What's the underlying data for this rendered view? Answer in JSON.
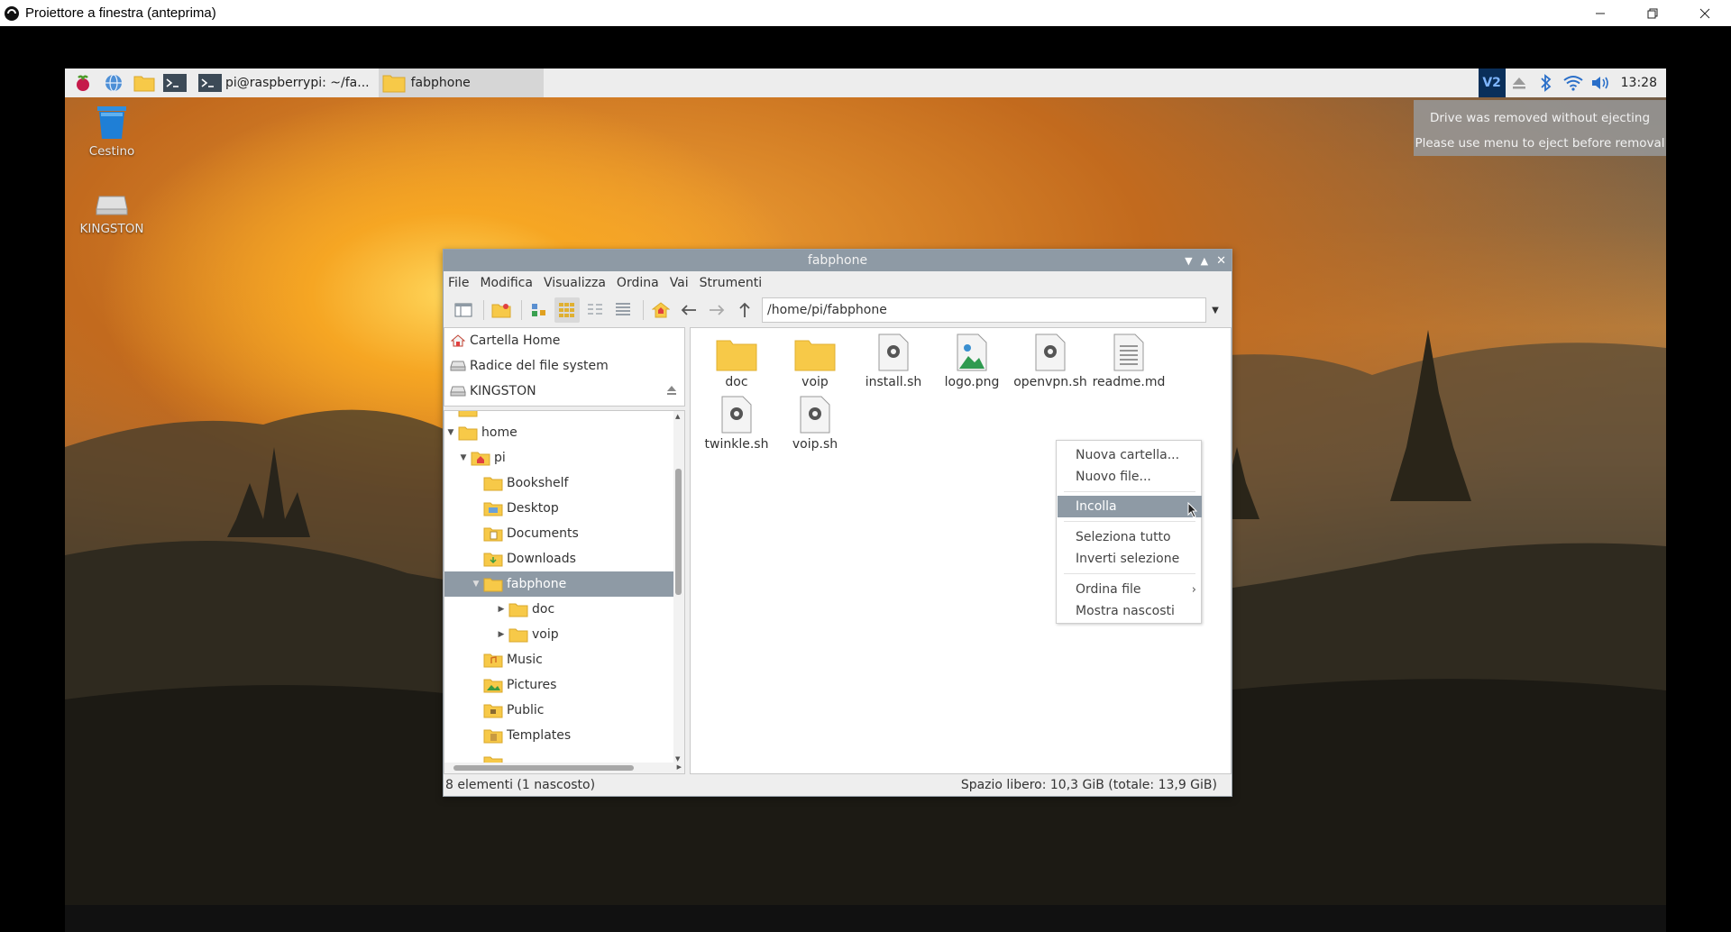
{
  "host": {
    "title": "Proiettore a finestra (anteprima)"
  },
  "taskbar": {
    "tasks": [
      {
        "label": "pi@raspberrypi: ~/fa...",
        "icon": "terminal-icon"
      },
      {
        "label": "fabphone",
        "icon": "folder-icon"
      }
    ],
    "clock": "13:28"
  },
  "notification": {
    "line1": "Drive was removed without ejecting",
    "line2": "Please use menu to eject before removal"
  },
  "desktop": {
    "icons": [
      {
        "label": "Cestino",
        "icon": "trash-icon"
      },
      {
        "label": "KINGSTON",
        "icon": "drive-icon"
      }
    ]
  },
  "file_manager": {
    "title": "fabphone",
    "menu": [
      "File",
      "Modifica",
      "Visualizza",
      "Ordina",
      "Vai",
      "Strumenti"
    ],
    "path": "/home/pi/fabphone",
    "places": [
      {
        "label": "Cartella Home",
        "icon": "home-icon"
      },
      {
        "label": "Radice del file system",
        "icon": "drive-icon"
      },
      {
        "label": "KINGSTON",
        "icon": "drive-icon"
      }
    ],
    "tree": [
      {
        "label": "home",
        "level": 0,
        "expanded": true
      },
      {
        "label": "pi",
        "level": 1,
        "expanded": true
      },
      {
        "label": "Bookshelf",
        "level": 2
      },
      {
        "label": "Desktop",
        "level": 2
      },
      {
        "label": "Documents",
        "level": 2
      },
      {
        "label": "Downloads",
        "level": 2
      },
      {
        "label": "fabphone",
        "level": 2,
        "selected": true
      },
      {
        "label": "doc",
        "level": 3
      },
      {
        "label": "voip",
        "level": 3
      },
      {
        "label": "Music",
        "level": 2
      },
      {
        "label": "Pictures",
        "level": 2
      },
      {
        "label": "Public",
        "level": 2
      },
      {
        "label": "Templates",
        "level": 2
      }
    ],
    "files": [
      {
        "name": "doc",
        "type": "folder"
      },
      {
        "name": "voip",
        "type": "folder"
      },
      {
        "name": "install.sh",
        "type": "script"
      },
      {
        "name": "logo.png",
        "type": "image"
      },
      {
        "name": "openvpn.sh",
        "type": "script"
      },
      {
        "name": "readme.md",
        "type": "text"
      },
      {
        "name": "twinkle.sh",
        "type": "script"
      },
      {
        "name": "voip.sh",
        "type": "script"
      }
    ],
    "status_left": "8 elementi (1 nascosto)",
    "status_right": "Spazio libero: 10,3 GiB (totale: 13,9 GiB)"
  },
  "context_menu": {
    "items": [
      "Nuova cartella...",
      "Nuovo file...",
      "Incolla",
      "Seleziona tutto",
      "Inverti selezione",
      "Ordina file",
      "Mostra nascosti"
    ],
    "highlighted": "Incolla"
  },
  "colors": {
    "selection": "#8e9aa5",
    "folder": "#f7c948"
  }
}
